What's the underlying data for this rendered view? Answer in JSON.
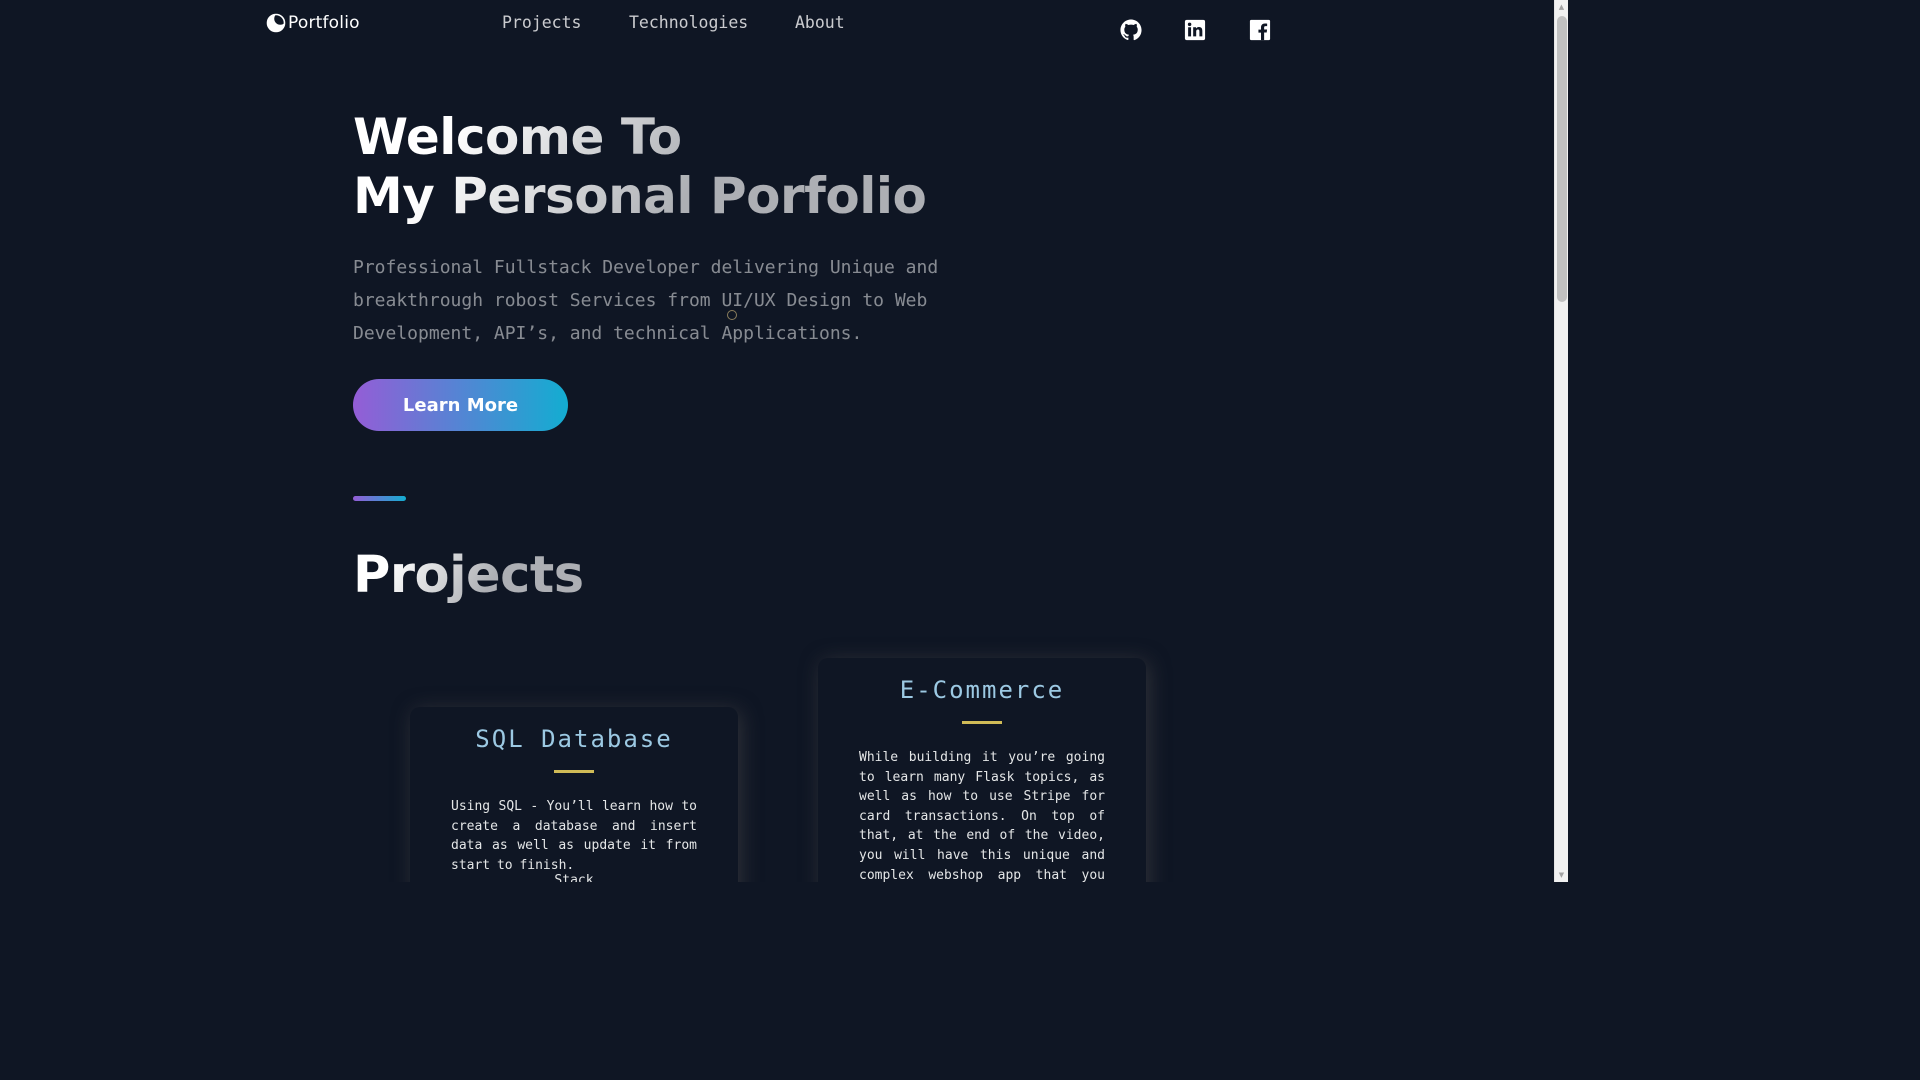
{
  "header": {
    "logo_text": "Portfolio",
    "nav": [
      "Projects",
      "Technologies",
      "About"
    ],
    "social": [
      "github-icon",
      "linkedin-icon",
      "facebook-icon"
    ]
  },
  "hero": {
    "title_line1": "Welcome To",
    "title_line2": "My Personal Porfolio",
    "description": "Professional Fullstack Developer delivering Unique and breakthrough robost Services from UI/UX Design to Web Development, API’s, and technical Applications.",
    "button_label": "Learn More"
  },
  "projects": {
    "section_title": "Projects",
    "cards": [
      {
        "title": "SQL Database",
        "description": "Using SQL - You’ll learn how to create a database and insert data as well as update it from start to finish.",
        "subtitle": "Stack"
      },
      {
        "title": "E-Commerce",
        "description": "While building it you’re going to learn many Flask topics, as well as how to use Stripe for card transactions. On top of that, at the end of the video, you will have this unique and complex webshop app that you will be able to add to your portfolio. And trust me, e-"
      }
    ]
  },
  "colors": {
    "background": "#0f1624",
    "accent_gradient_start": "#945dd6",
    "accent_gradient_end": "#13add1",
    "card_title": "#9cc9e3",
    "card_divider": "#d0bb57"
  }
}
